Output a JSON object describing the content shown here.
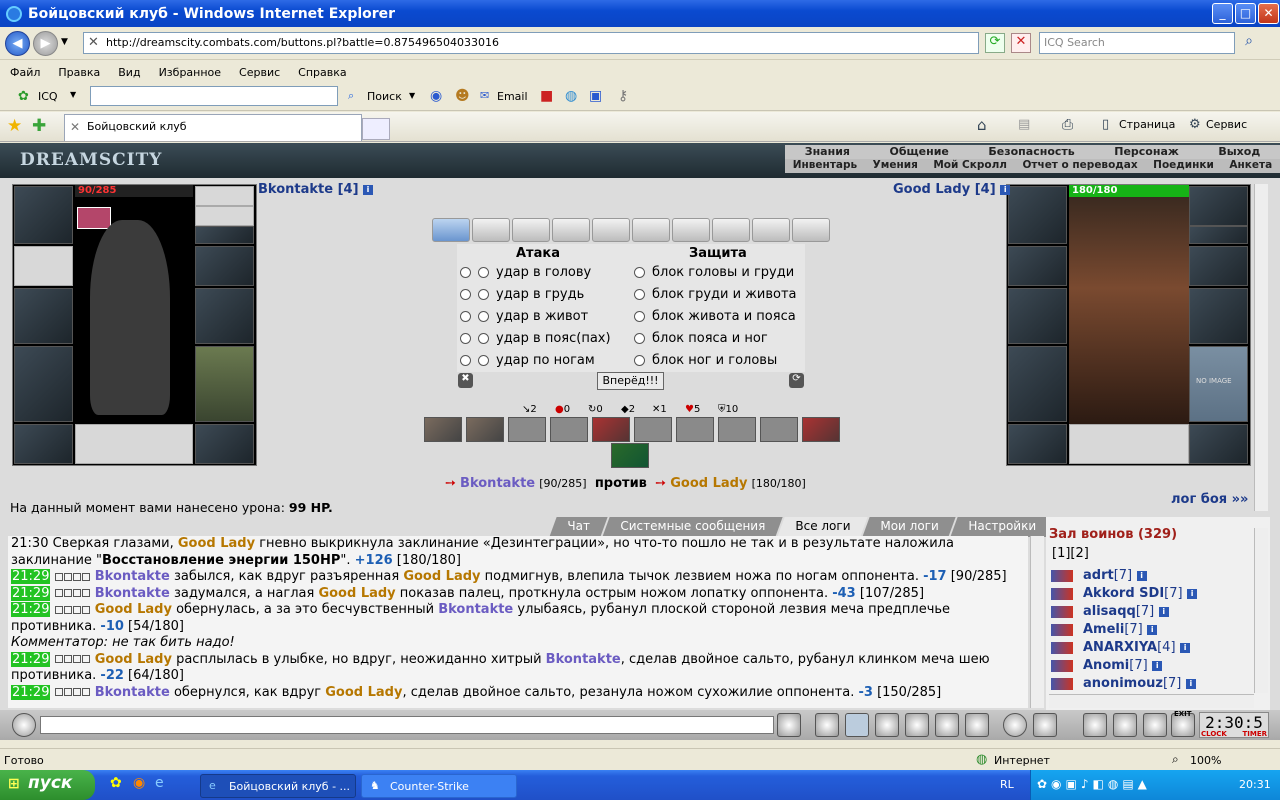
{
  "window": {
    "title": "Бойцовский клуб - Windows Internet Explorer"
  },
  "browser": {
    "url": "http://dreamscity.combats.com/buttons.pl?battle=0.875496504033016",
    "search_placeholder": "ICQ Search",
    "menu": [
      "Файл",
      "Правка",
      "Вид",
      "Избранное",
      "Сервис",
      "Справка"
    ],
    "toolbar": {
      "icq": "ICQ",
      "search": "Поиск",
      "email": "Email"
    },
    "tab_title": "Бойцовский клуб",
    "cmd": {
      "page": "Страница",
      "service": "Сервис"
    }
  },
  "site": {
    "logo": "DREAMSCITY",
    "nav_top": [
      "Знания",
      "Общение",
      "Безопасность",
      "Персонаж",
      "Выход"
    ],
    "nav_bottom": [
      "Инвентарь",
      "Умения",
      "Мой Скролл",
      "Отчет о переводах",
      "Поединки",
      "Анкета"
    ]
  },
  "battle": {
    "player": {
      "name": "Bkontakte [4]",
      "hp": "90/285"
    },
    "enemy": {
      "name": "Good Lady [4]",
      "hp": "180/180",
      "no_image": "NO IMAGE"
    },
    "attack_header": "Атака",
    "defense_header": "Защита",
    "attacks": [
      "удар в голову",
      "удар в грудь",
      "удар в живот",
      "удар в пояс(пах)",
      "удар по ногам"
    ],
    "blocks": [
      "блок головы и груди",
      "блок груди и живота",
      "блок живота и пояса",
      "блок пояса и ног",
      "блок ног и головы"
    ],
    "go_button": "Вперёд!!!",
    "stats": [
      "2",
      "0",
      "0",
      "2",
      "1",
      "5",
      "10"
    ],
    "vs": {
      "p1": "Bkontakte",
      "p1_hp": "[90/285]",
      "word": "против",
      "p2": "Good Lady",
      "p2_hp": "[180/180]"
    },
    "damage_label": "На данный момент вами нанесено урона:",
    "damage_value": "99 HP.",
    "log_link": "лог боя »»"
  },
  "chat": {
    "tabs": [
      "Чат",
      "Системные сообщения",
      "Все логи",
      "Мои логи",
      "Настройки"
    ],
    "active_tab": 2
  },
  "room": {
    "title": "Зал воинов (329)",
    "pages": "[1][2]",
    "users": [
      {
        "name": "adrt",
        "level": "[7]"
      },
      {
        "name": "Akkord SDI",
        "level": "[7]"
      },
      {
        "name": "alisaqq",
        "level": "[7]"
      },
      {
        "name": "Ameli",
        "level": "[7]"
      },
      {
        "name": "ANARXIYA",
        "level": "[4]"
      },
      {
        "name": "Anomi",
        "level": "[7]"
      },
      {
        "name": "anonimouz",
        "level": "[7]"
      }
    ]
  },
  "gamebar": {
    "clock": "2:30:5",
    "clock_label": "CLOCK",
    "timer_label": "TIMER",
    "exit_label": "EXIT"
  },
  "status": {
    "ready": "Готово",
    "zone": "Интернет",
    "zoom": "100%"
  },
  "taskbar": {
    "start": "пуск",
    "task1": "Бойцовский клуб - ...",
    "task2": "Counter-Strike",
    "lang": "RL",
    "time": "20:31"
  }
}
